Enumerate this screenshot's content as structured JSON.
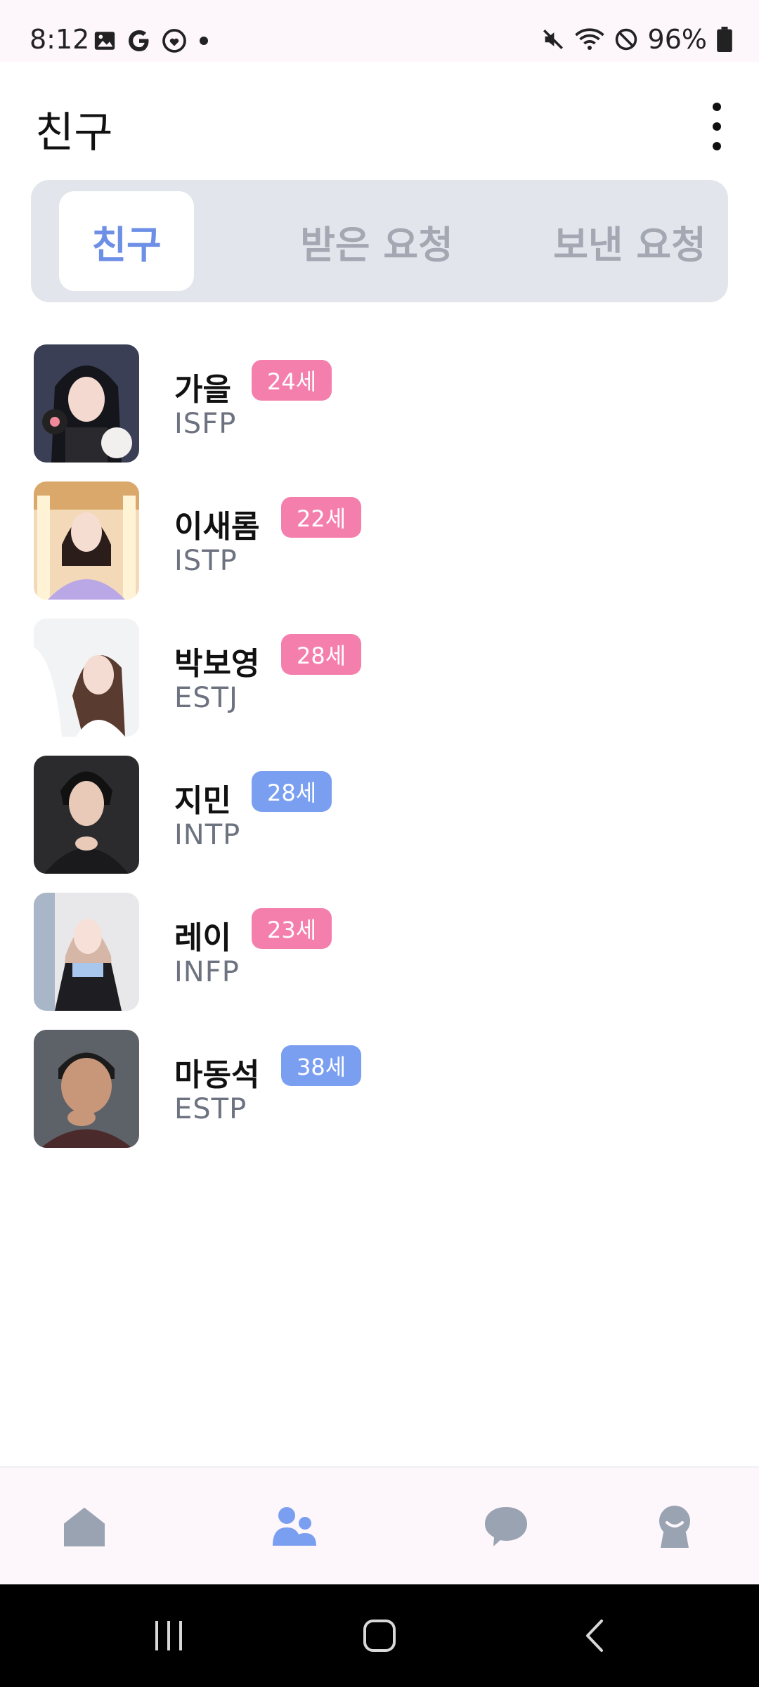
{
  "status_bar": {
    "time": "8:12",
    "battery": "96%"
  },
  "app_bar": {
    "title": "친구"
  },
  "tabs": [
    {
      "label": "친구",
      "active": true
    },
    {
      "label": "받은 요청",
      "active": false
    },
    {
      "label": "보낸 요청",
      "active": false
    }
  ],
  "friends": [
    {
      "name": "가을",
      "age": "24세",
      "mbti": "ISFP",
      "badge_color": "#f47fad"
    },
    {
      "name": "이새롬",
      "age": "22세",
      "mbti": "ISTP",
      "badge_color": "#f47fad"
    },
    {
      "name": "박보영",
      "age": "28세",
      "mbti": "ESTJ",
      "badge_color": "#f47fad"
    },
    {
      "name": "지민",
      "age": "28세",
      "mbti": "INTP",
      "badge_color": "#7b9ff0"
    },
    {
      "name": "레이",
      "age": "23세",
      "mbti": "INFP",
      "badge_color": "#f47fad"
    },
    {
      "name": "마동석",
      "age": "38세",
      "mbti": "ESTP",
      "badge_color": "#7b9ff0"
    }
  ],
  "bottom_nav": [
    {
      "icon": "home-icon",
      "active": false
    },
    {
      "icon": "friends-icon",
      "active": true
    },
    {
      "icon": "chat-icon",
      "active": false
    },
    {
      "icon": "profile-icon",
      "active": false
    }
  ],
  "colors": {
    "accent": "#6e8fe6",
    "female_badge": "#f47fad",
    "male_badge": "#7b9ff0",
    "inactive_icon": "#9aa3b2"
  }
}
